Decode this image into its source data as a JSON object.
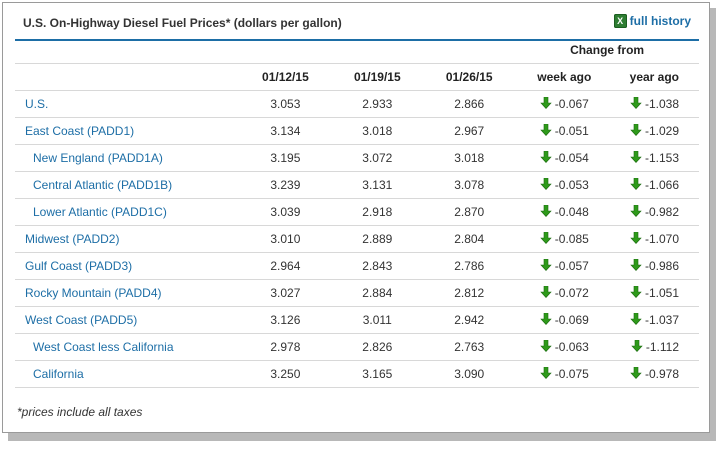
{
  "title": "U.S. On-Highway Diesel Fuel Prices*  (dollars per gallon)",
  "full_history_label": "full history",
  "change_from_label": "Change from",
  "columns": {
    "dates": [
      "01/12/15",
      "01/19/15",
      "01/26/15"
    ],
    "week_ago": "week ago",
    "year_ago": "year ago"
  },
  "rows": [
    {
      "region": "U.S.",
      "p1": "3.053",
      "p2": "2.933",
      "p3": "2.866",
      "week": "-0.067",
      "year": "-1.038"
    },
    {
      "region": "East Coast (PADD1)",
      "p1": "3.134",
      "p2": "3.018",
      "p3": "2.967",
      "week": "-0.051",
      "year": "-1.029"
    },
    {
      "region": "New England (PADD1A)",
      "p1": "3.195",
      "p2": "3.072",
      "p3": "3.018",
      "week": "-0.054",
      "year": "-1.153"
    },
    {
      "region": "Central Atlantic (PADD1B)",
      "p1": "3.239",
      "p2": "3.131",
      "p3": "3.078",
      "week": "-0.053",
      "year": "-1.066"
    },
    {
      "region": "Lower Atlantic (PADD1C)",
      "p1": "3.039",
      "p2": "2.918",
      "p3": "2.870",
      "week": "-0.048",
      "year": "-0.982"
    },
    {
      "region": "Midwest (PADD2)",
      "p1": "3.010",
      "p2": "2.889",
      "p3": "2.804",
      "week": "-0.085",
      "year": "-1.070"
    },
    {
      "region": "Gulf Coast (PADD3)",
      "p1": "2.964",
      "p2": "2.843",
      "p3": "2.786",
      "week": "-0.057",
      "year": "-0.986"
    },
    {
      "region": "Rocky Mountain (PADD4)",
      "p1": "3.027",
      "p2": "2.884",
      "p3": "2.812",
      "week": "-0.072",
      "year": "-1.051"
    },
    {
      "region": "West Coast (PADD5)",
      "p1": "3.126",
      "p2": "3.011",
      "p3": "2.942",
      "week": "-0.069",
      "year": "-1.037"
    },
    {
      "region": "West Coast less California",
      "p1": "2.978",
      "p2": "2.826",
      "p3": "2.763",
      "week": "-0.063",
      "year": "-1.112"
    },
    {
      "region": "California",
      "p1": "3.250",
      "p2": "3.165",
      "p3": "3.090",
      "week": "-0.075",
      "year": "-0.978"
    }
  ],
  "footnote": "*prices include all taxes",
  "icons": {
    "history": "spreadsheet-icon",
    "change": "down-arrow-icon"
  },
  "colors": {
    "accent": "#1d6ea6",
    "down_arrow": "#2e9a1a",
    "text": "#333333",
    "rule": "#d8d8d8"
  }
}
